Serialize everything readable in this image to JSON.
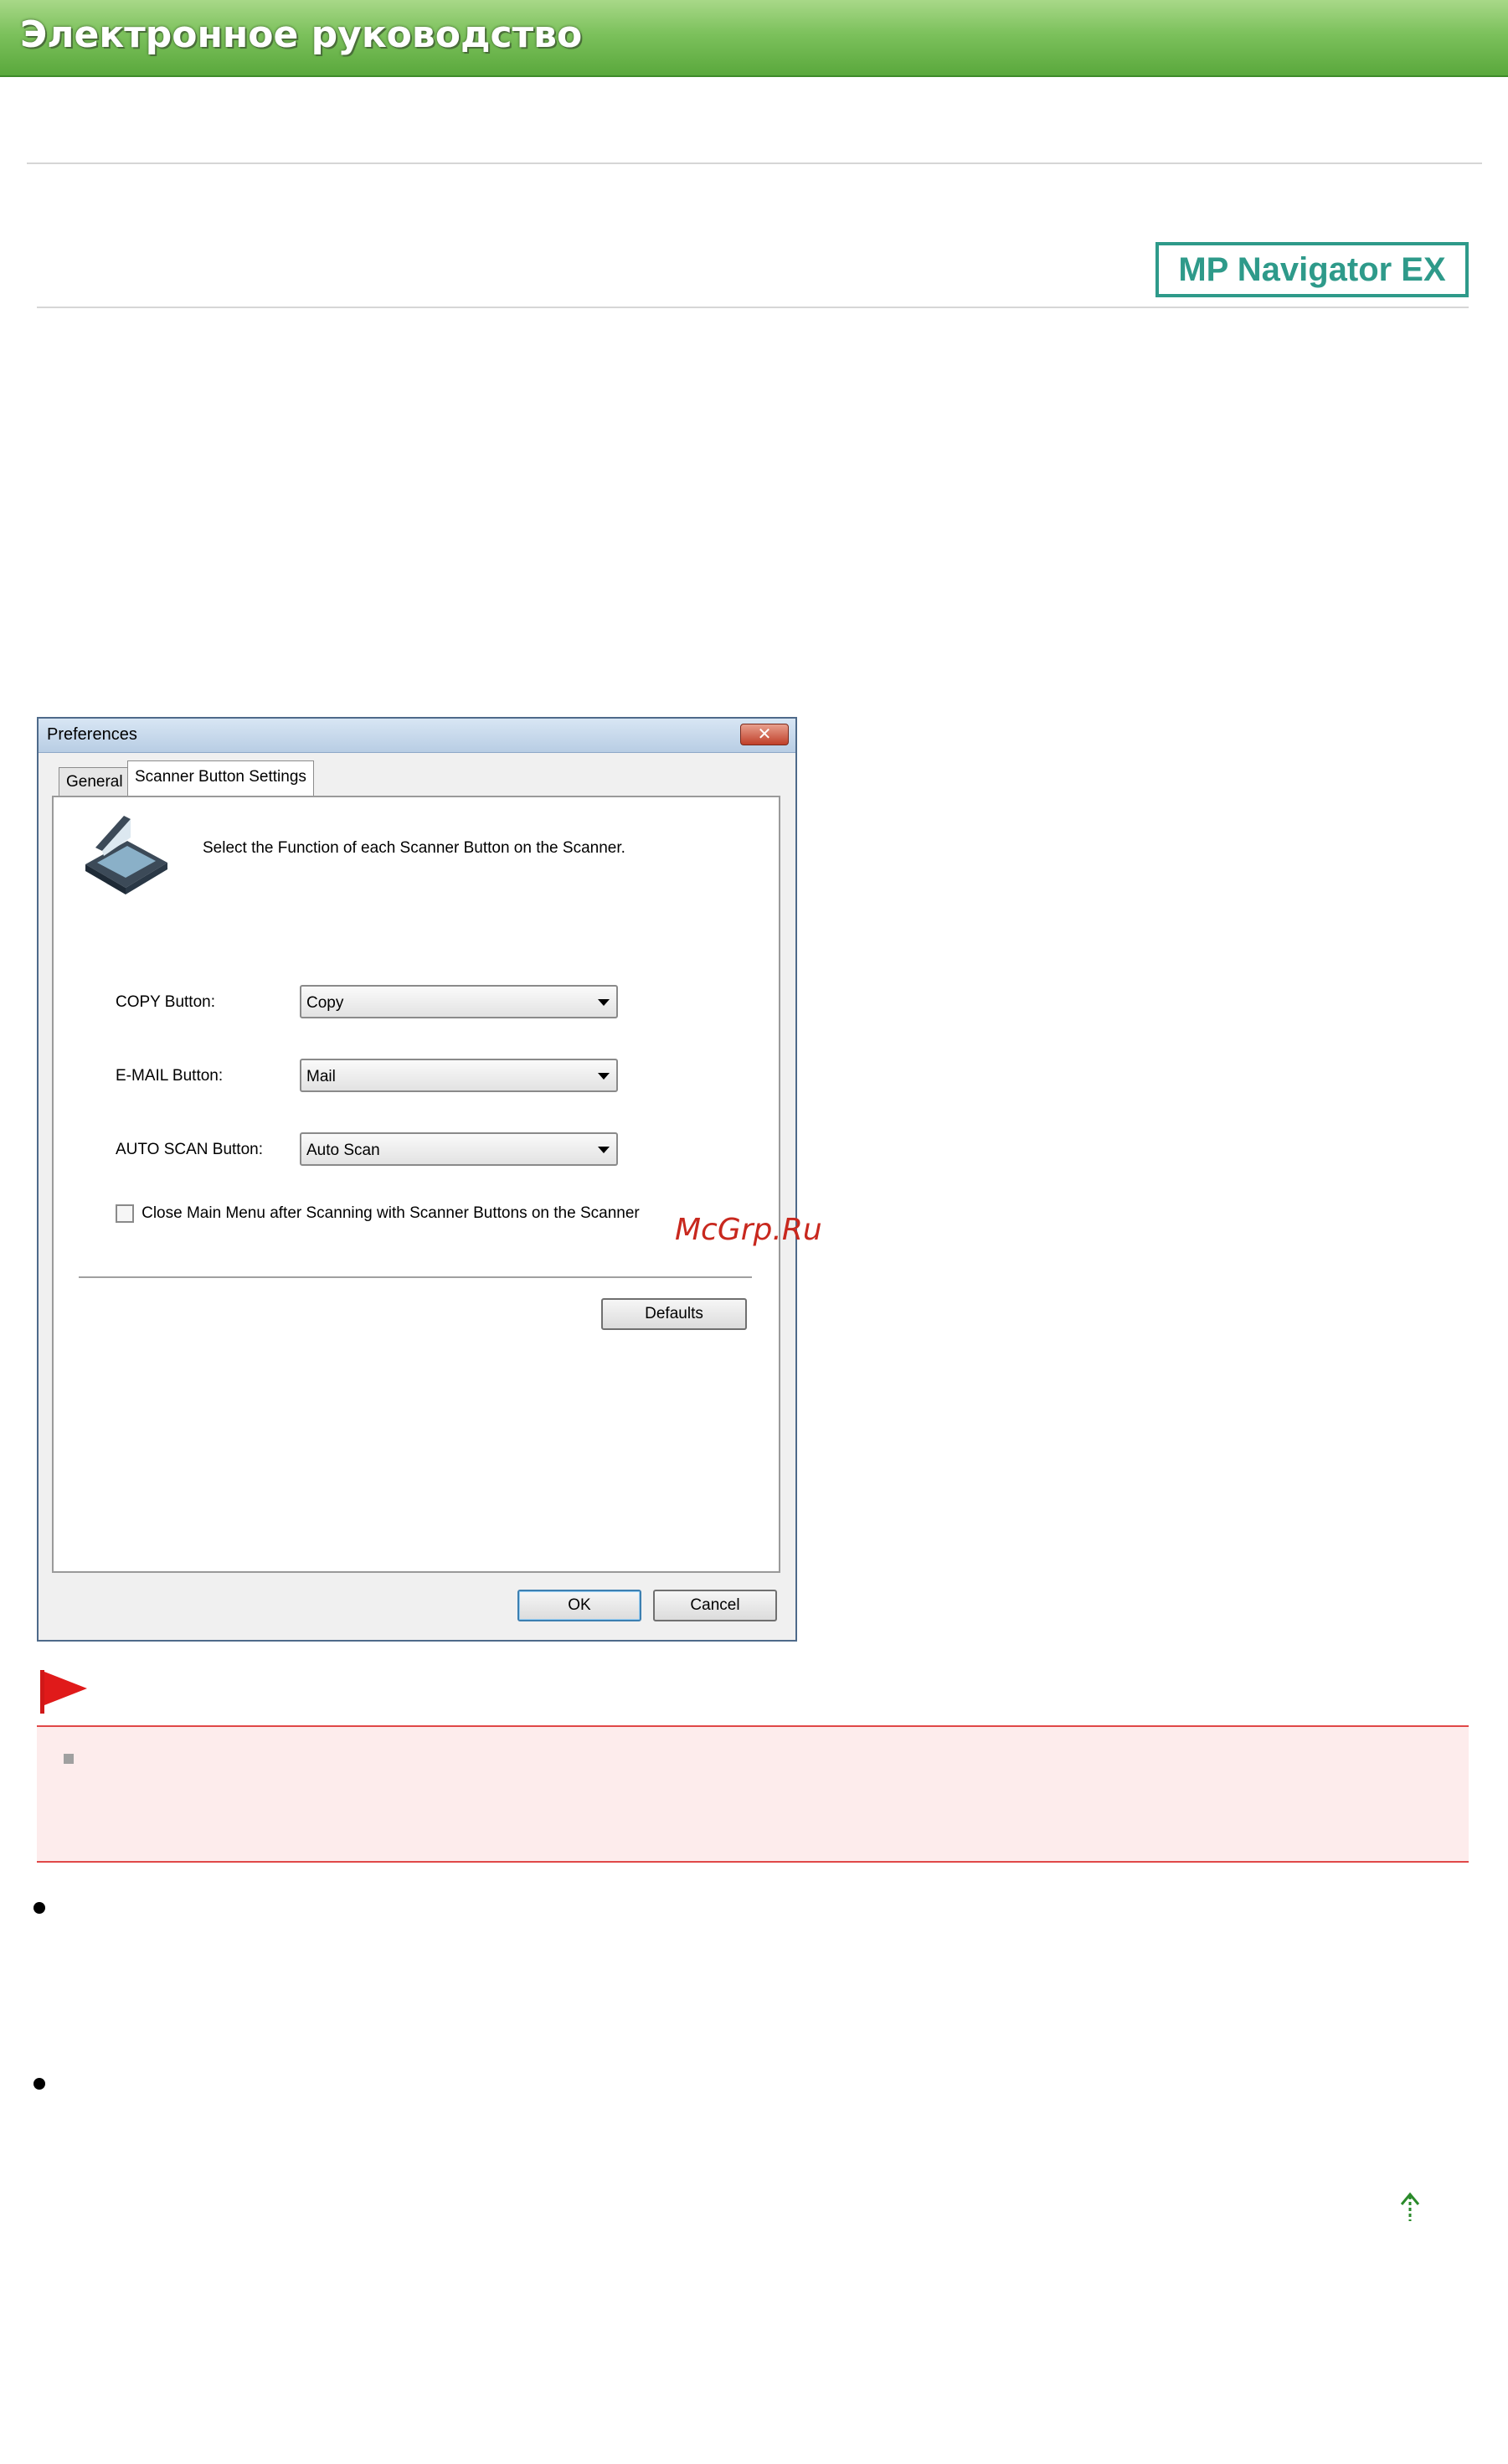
{
  "banner": {
    "title": "Электронное руководство"
  },
  "product_logo": {
    "text": "MP Navigator EX"
  },
  "dialog": {
    "title": "Preferences",
    "close_icon": "close-icon",
    "tabs": [
      {
        "label": "General",
        "active": false
      },
      {
        "label": "Scanner Button Settings",
        "active": true
      }
    ],
    "description": "Select the Function of each Scanner Button on the Scanner.",
    "fields": [
      {
        "label": "COPY Button:",
        "value": "Copy"
      },
      {
        "label": "E-MAIL Button:",
        "value": "Mail"
      },
      {
        "label": "AUTO SCAN Button:",
        "value": "Auto Scan"
      }
    ],
    "checkbox": {
      "label": "Close Main Menu after Scanning with Scanner Buttons on the Scanner",
      "checked": false
    },
    "buttons": {
      "defaults": "Defaults",
      "ok": "OK",
      "cancel": "Cancel"
    }
  },
  "watermark": "McGrp.Ru",
  "icons": {
    "scanner": "scanner-icon",
    "flag": "important-flag-icon",
    "back_to_top": "back-to-top-arrow-icon"
  },
  "colors": {
    "banner_green": "#7cc15c",
    "logo_teal": "#2e9a8a",
    "note_background": "#fdecec",
    "note_border": "#e04848",
    "watermark_red": "#c8281e"
  }
}
